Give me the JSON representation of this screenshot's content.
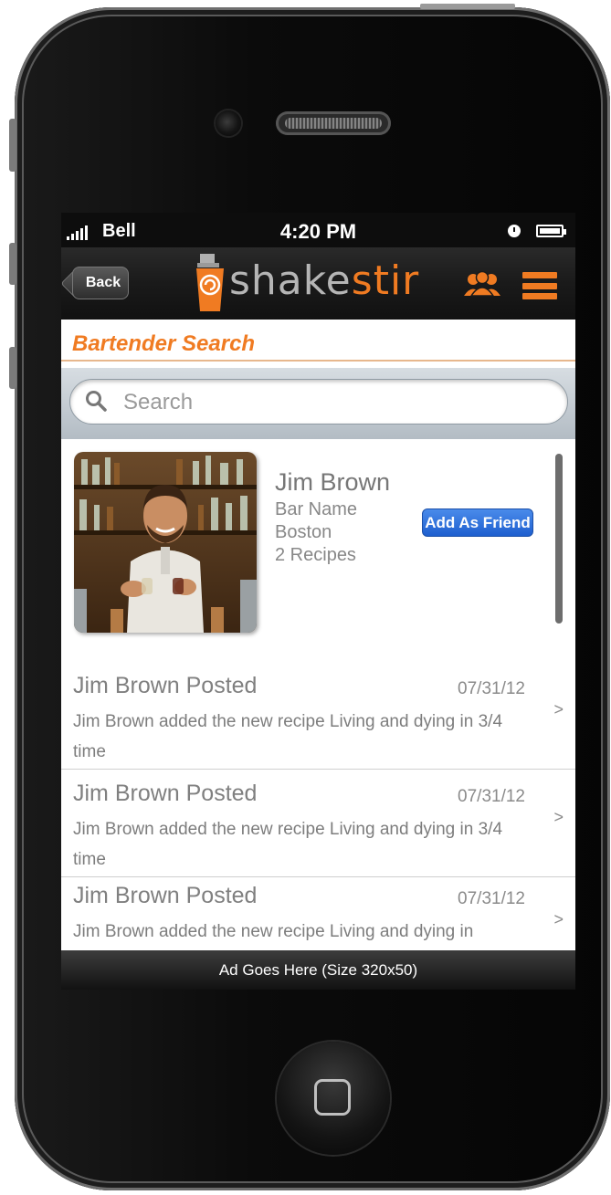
{
  "status_bar": {
    "carrier": "Bell",
    "time": "4:20 PM"
  },
  "nav": {
    "back_label": "Back",
    "logo_part1": "shake",
    "logo_part2": "stir"
  },
  "page": {
    "title": "Bartender Search"
  },
  "search": {
    "placeholder": "Search",
    "value": ""
  },
  "profile": {
    "name": "Jim Brown",
    "bar": "Bar Name",
    "city": "Boston",
    "recipes": "2 Recipes",
    "add_friend_label": "Add As Friend"
  },
  "feed": [
    {
      "title": "Jim Brown Posted",
      "date": "07/31/12",
      "body": "Jim Brown added the new recipe Living and dying in 3/4 time",
      "chevron": ">"
    },
    {
      "title": "Jim Brown Posted",
      "date": "07/31/12",
      "body": "Jim Brown added the new recipe Living and dying in 3/4 time",
      "chevron": ">"
    },
    {
      "title": "Jim Brown Posted",
      "date": "07/31/12",
      "body": "Jim Brown added the new recipe Living and dying in",
      "chevron": ">"
    }
  ],
  "ad": {
    "text": "Ad Goes Here (Size 320x50)"
  },
  "colors": {
    "brand_orange": "#f07b22",
    "button_blue": "#2f74df"
  },
  "icons": [
    "signal-icon",
    "alarm-icon",
    "battery-icon",
    "cup-logo-icon",
    "friends-icon",
    "menu-icon",
    "search-icon",
    "chevron-right-icon"
  ]
}
